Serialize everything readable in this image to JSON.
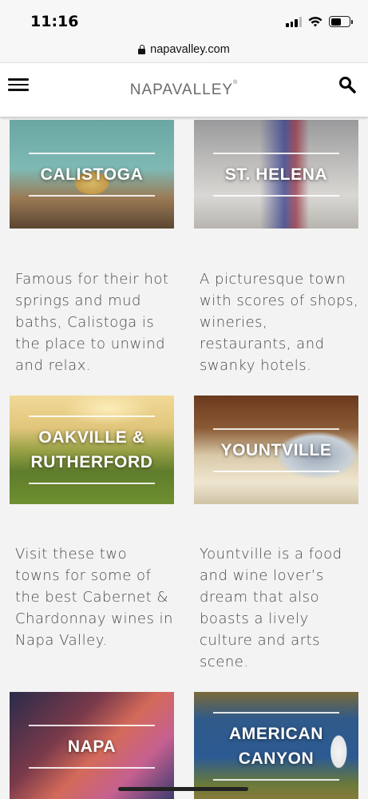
{
  "status_bar": {
    "time": "11:16",
    "signal_bars": 3,
    "battery_level": 0.55
  },
  "browser": {
    "url": "napavalley.com",
    "secure": true
  },
  "header": {
    "logo_text": "NAPAVALLEY",
    "logo_mark": "®",
    "menu_icon": "hamburger-menu-icon",
    "search_icon": "search-icon"
  },
  "towns": [
    {
      "title": "CALISTOGA",
      "title_lines": [
        "CALISTOGA"
      ],
      "description": "Famous for their hot springs and mud baths, Calistoga is the place to unwind and relax."
    },
    {
      "title": "ST. HELENA",
      "title_lines": [
        "ST. HELENA"
      ],
      "description": "A picturesque town with scores of shops, wineries, restaurants, and swanky hotels."
    },
    {
      "title": "OAKVILLE & RUTHERFORD",
      "title_lines": [
        "OAKVILLE &",
        "RUTHERFORD"
      ],
      "description": "Visit these two towns for some of the best Cabernet & Chardonnay wines in Napa Valley."
    },
    {
      "title": "YOUNTVILLE",
      "title_lines": [
        "YOUNTVILLE"
      ],
      "description": "Yountville is a food and wine lover’s dream that also boasts a lively culture and arts scene."
    },
    {
      "title": "NAPA",
      "title_lines": [
        "NAPA"
      ],
      "description": ""
    },
    {
      "title": "AMERICAN CANYON",
      "title_lines": [
        "AMERICAN",
        "CANYON"
      ],
      "description": ""
    }
  ]
}
